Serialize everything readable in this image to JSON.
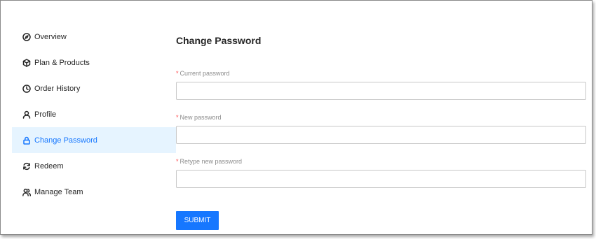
{
  "sidebar": {
    "items": [
      {
        "label": "Overview",
        "icon": "compass-icon",
        "active": false
      },
      {
        "label": "Plan & Products",
        "icon": "box-icon",
        "active": false
      },
      {
        "label": "Order History",
        "icon": "clock-icon",
        "active": false
      },
      {
        "label": "Profile",
        "icon": "user-icon",
        "active": false
      },
      {
        "label": "Change Password",
        "icon": "lock-icon",
        "active": true
      },
      {
        "label": "Redeem",
        "icon": "refresh-icon",
        "active": false
      },
      {
        "label": "Manage Team",
        "icon": "team-icon",
        "active": false
      }
    ]
  },
  "main": {
    "title": "Change Password",
    "required_marker": "*",
    "fields": [
      {
        "label": "Current password",
        "value": ""
      },
      {
        "label": "New password",
        "value": ""
      },
      {
        "label": "Retype new password",
        "value": ""
      }
    ],
    "submit_label": "SUBMIT"
  },
  "colors": {
    "accent": "#1677ff",
    "active_background": "#e6f4ff",
    "required": "#ff4d4f"
  }
}
